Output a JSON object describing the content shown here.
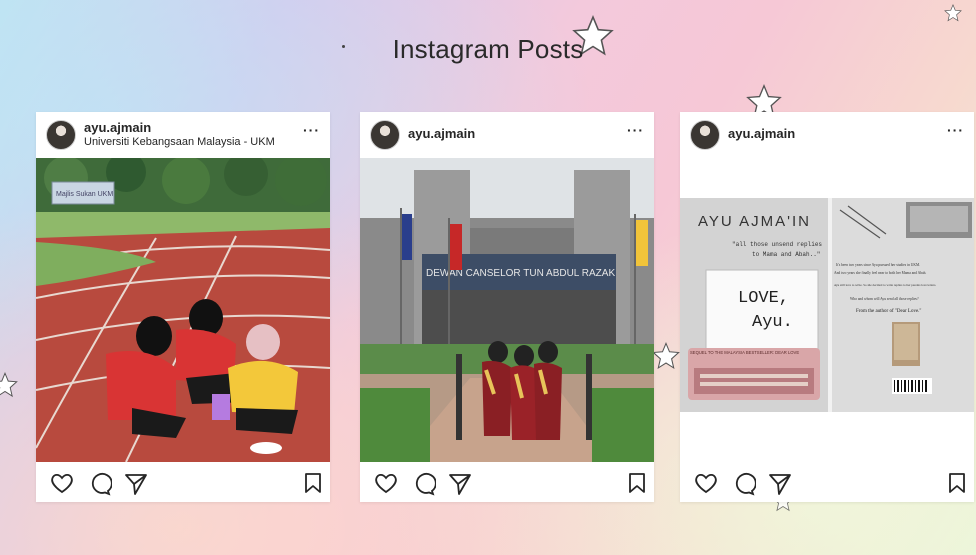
{
  "page": {
    "title": "Instagram Posts"
  },
  "posts": [
    {
      "username": "ayu.ajmain",
      "location": "Universiti Kebangsaan Malaysia - UKM",
      "more": "···",
      "image": "students-sitting-on-running-track",
      "photo_text": {
        "sign": "Majlis Sukan UKM"
      }
    },
    {
      "username": "ayu.ajmain",
      "location": "",
      "more": "···",
      "image": "graduates-in-front-of-dewan-canselor",
      "photo_text": {
        "building_sign": "DEWAN CANSELOR TUN ABDUL RAZAK"
      }
    },
    {
      "username": "ayu.ajmain",
      "location": "",
      "more": "···",
      "image": "dear-love-book-cover",
      "photo_text": {
        "author": "AYU AJMA'IN",
        "tagline_1": "\"all those unsend replies",
        "tagline_2": "to Mama and Abah..\"",
        "book_title_1": "LOVE,",
        "book_title_2": "Ayu.",
        "sequel": "SEQUEL TO THE MALAYSIA BESTSELLER: DEAR LOVE",
        "blurb_1": "It's been two years since Ayu pursued her studies in UKM.",
        "blurb_2": "And two years she finally feel near to both her Mama and Abah.",
        "blurb_3": "Ayu still love to write. So she decided to write replies to her parents love letters.",
        "blurb_4": "Who and whom will Ayu send all those replies?",
        "blurb_5": "From the author of \"Dear Love.\""
      }
    }
  ],
  "icons": [
    "heart-icon",
    "comment-icon",
    "share-icon",
    "bookmark-icon"
  ]
}
